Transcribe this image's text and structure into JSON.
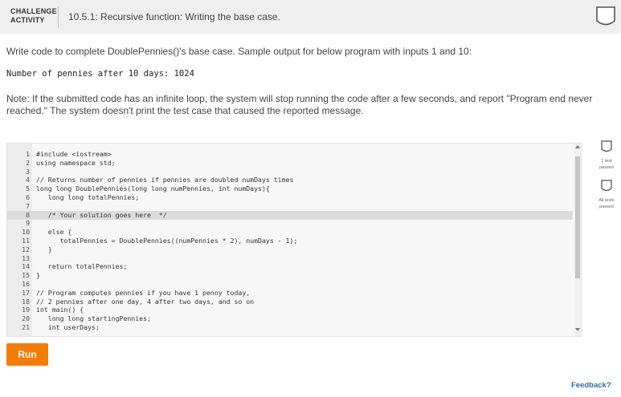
{
  "header": {
    "label_line1": "CHALLENGE",
    "label_line2": "ACTIVITY",
    "title": "10.5.1: Recursive function: Writing the base case."
  },
  "description": "Write code to complete DoublePennies()'s base case. Sample output for below program with inputs 1 and 10:",
  "sample_output": "Number of pennies after 10 days: 1024",
  "note": "Note: If the submitted code has an infinite loop, the system will stop running the code after a few seconds, and report \"Program end never reached.\" The system doesn't print the test case that caused the reported message.",
  "editor": {
    "lines": [
      {
        "num": "1",
        "text": "#include <iostream>",
        "highlighted": false
      },
      {
        "num": "2",
        "text": "using namespace std;",
        "highlighted": false
      },
      {
        "num": "3",
        "text": "",
        "highlighted": false
      },
      {
        "num": "4",
        "text": "// Returns number of pennies if pennies are doubled numDays times",
        "highlighted": false
      },
      {
        "num": "5",
        "text": "long long DoublePennies(long long numPennies, int numDays){",
        "highlighted": false
      },
      {
        "num": "6",
        "text": "   long long totalPennies;",
        "highlighted": false
      },
      {
        "num": "7",
        "text": "",
        "highlighted": false
      },
      {
        "num": "8",
        "text": "   /* Your solution goes here  */",
        "highlighted": true
      },
      {
        "num": "9",
        "text": "",
        "highlighted": false
      },
      {
        "num": "10",
        "text": "   else {",
        "highlighted": false
      },
      {
        "num": "11",
        "text": "      totalPennies = DoublePennies((numPennies * 2), numDays - 1);",
        "highlighted": false
      },
      {
        "num": "12",
        "text": "   }",
        "highlighted": false
      },
      {
        "num": "13",
        "text": "",
        "highlighted": false
      },
      {
        "num": "14",
        "text": "   return totalPennies;",
        "highlighted": false
      },
      {
        "num": "15",
        "text": "}",
        "highlighted": false
      },
      {
        "num": "16",
        "text": "",
        "highlighted": false
      },
      {
        "num": "17",
        "text": "// Program computes pennies if you have 1 penny today,",
        "highlighted": false
      },
      {
        "num": "18",
        "text": "// 2 pennies after one day, 4 after two days, and so on",
        "highlighted": false
      },
      {
        "num": "19",
        "text": "int main() {",
        "highlighted": false
      },
      {
        "num": "20",
        "text": "   long long startingPennies;",
        "highlighted": false
      },
      {
        "num": "21",
        "text": "   int userDays;",
        "highlighted": false
      }
    ]
  },
  "run_label": "Run",
  "tests": [
    {
      "line1": "1 test",
      "line2": "passed"
    },
    {
      "line1": "All tests",
      "line2": "passed"
    }
  ],
  "feedback_label": "Feedback?",
  "colors": {
    "accent": "#f57c00",
    "header_bg": "#efefef",
    "link": "#2a6fb0",
    "highlight_line": "#dcdcdc"
  },
  "icons": {
    "completion": "shield-outline-icon",
    "test_status": "checkbox-outline-icon"
  }
}
